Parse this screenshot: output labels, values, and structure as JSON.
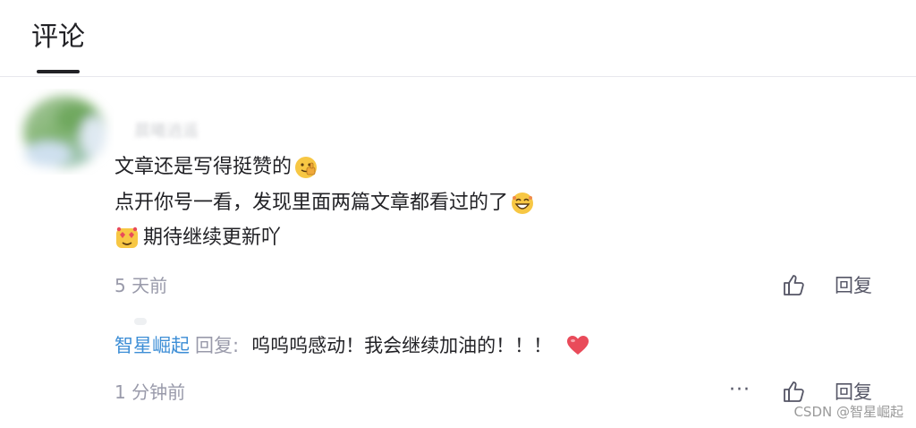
{
  "tabs": {
    "active_label": "评论"
  },
  "comment": {
    "username": "晨曦逍遥",
    "lines": [
      "文章还是写得挺赞的",
      "点开你号一看，发现里面两篇文章都看过的了",
      "期待继续更新吖"
    ],
    "time": "5 天前",
    "reply_label": "回复",
    "emoji": [
      "thumb-up-face-emoji",
      "grinning-face-emoji",
      "heart-eyes-face-emoji"
    ],
    "like_icon": "thumb-up-outline-icon"
  },
  "reply": {
    "author": "智星崛起",
    "reply_word": "回复",
    "colon": ":",
    "text": "呜呜呜感动！我会继续加油的！！！",
    "time": "1 分钟前",
    "more_label": "···",
    "reply_label": "回复",
    "heart_icon": "red-heart-emoji"
  },
  "watermark": "CSDN @智星崛起",
  "colors": {
    "link": "#3d8ed6",
    "text": "#222226",
    "muted": "#999aaa",
    "heart": "#e94b5a"
  }
}
